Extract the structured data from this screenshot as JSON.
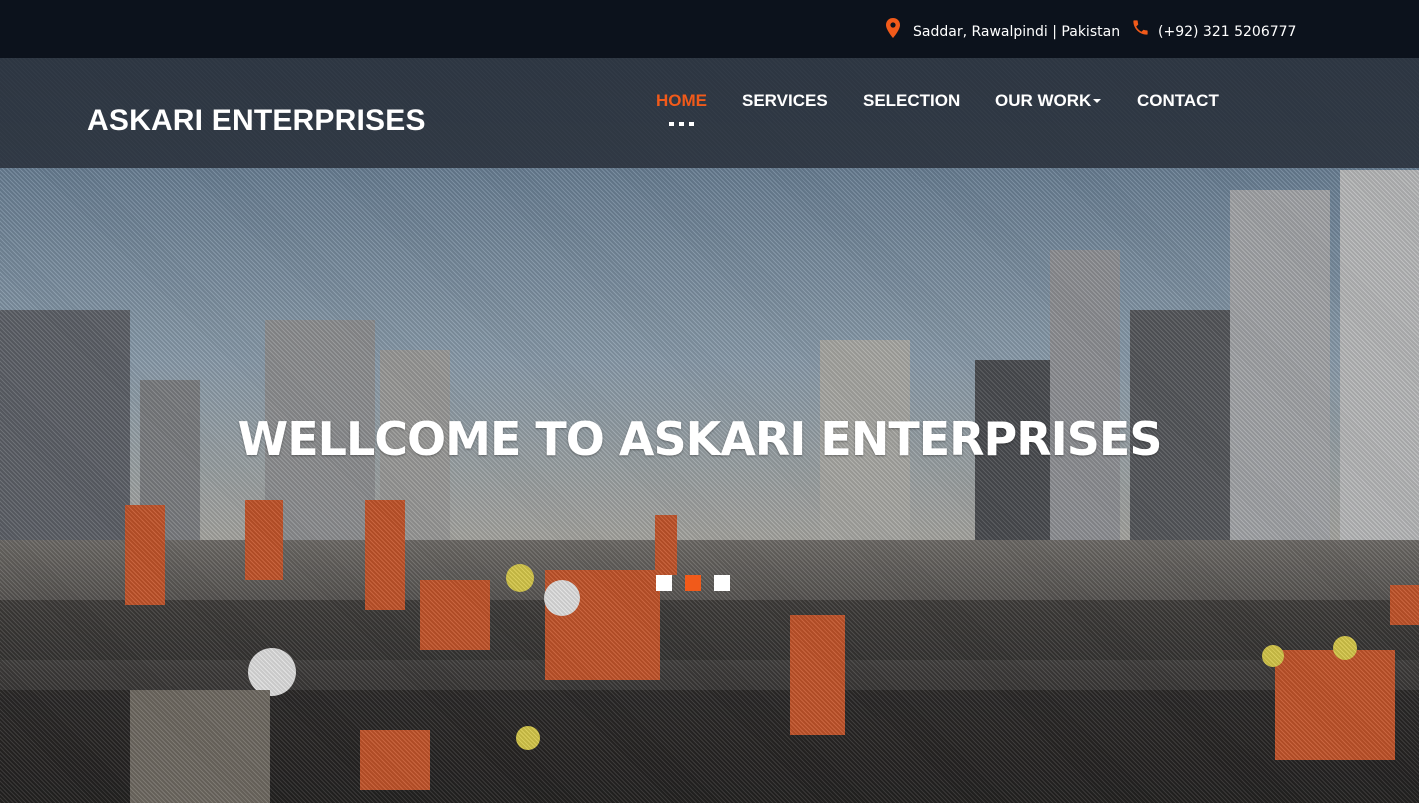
{
  "topbar": {
    "location_icon": "map-pin-icon",
    "location_text": "Saddar, Rawalpindi | Pakistan",
    "phone_icon": "phone-icon",
    "phone_text": "(+92) 321 5206777"
  },
  "header": {
    "brand": "ASKARI ENTERPRISES",
    "nav": [
      {
        "label": "HOME",
        "active": true
      },
      {
        "label": "SERVICES",
        "active": false
      },
      {
        "label": "SELECTION",
        "active": false
      },
      {
        "label": "OUR WORK",
        "active": false,
        "dropdown": true
      },
      {
        "label": "CONTACT",
        "active": false
      }
    ]
  },
  "hero": {
    "title": "WELLCOME TO ASKARI ENTERPRISES",
    "slides": 3,
    "active_slide": 2
  },
  "colors": {
    "accent": "#f15a1a",
    "topbar_bg": "#0c121c",
    "text": "#ffffff"
  }
}
